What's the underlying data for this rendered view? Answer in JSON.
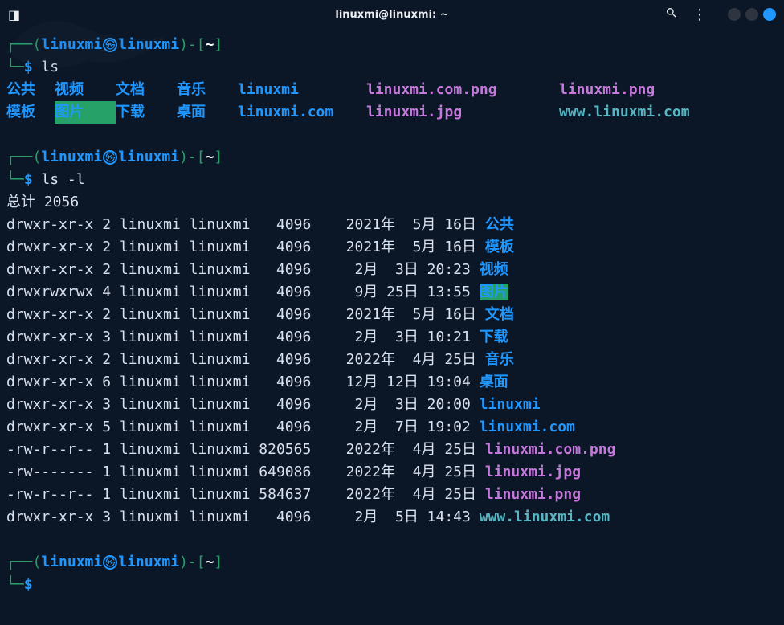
{
  "titlebar": {
    "title": "linuxmi@linuxmi: ~"
  },
  "prompt": {
    "user": "linuxmi",
    "host": "linuxmi",
    "path": "~",
    "symbol": "$"
  },
  "cmd1": "ls",
  "ls_short": {
    "row1": [
      {
        "text": "公共",
        "cls": "dir"
      },
      {
        "text": "视频",
        "cls": "dir"
      },
      {
        "text": "文档",
        "cls": "dir"
      },
      {
        "text": "音乐",
        "cls": "dir"
      },
      {
        "text": "linuxmi",
        "cls": "dir"
      },
      {
        "text": "linuxmi.com.png",
        "cls": "img"
      },
      {
        "text": "linuxmi.png",
        "cls": "img"
      }
    ],
    "row2": [
      {
        "text": "模板",
        "cls": "dir"
      },
      {
        "text": "图片",
        "cls": "dir-ow"
      },
      {
        "text": "下载",
        "cls": "dir"
      },
      {
        "text": "桌面",
        "cls": "dir"
      },
      {
        "text": "linuxmi.com",
        "cls": "dir"
      },
      {
        "text": "linuxmi.jpg",
        "cls": "img"
      },
      {
        "text": "www.linuxmi.com",
        "cls": "lnk"
      }
    ]
  },
  "cmd2": "ls -l",
  "total_line": "总计 2056",
  "long": [
    {
      "perm": "drwxr-xr-x",
      "lnk": "2",
      "own": "linuxmi",
      "grp": "linuxmi",
      "size": "4096",
      "date": "2021年  5月 16日",
      "name": "公共",
      "cls": "dir"
    },
    {
      "perm": "drwxr-xr-x",
      "lnk": "2",
      "own": "linuxmi",
      "grp": "linuxmi",
      "size": "4096",
      "date": "2021年  5月 16日",
      "name": "模板",
      "cls": "dir"
    },
    {
      "perm": "drwxr-xr-x",
      "lnk": "2",
      "own": "linuxmi",
      "grp": "linuxmi",
      "size": "4096",
      "date": " 2月  3日 20:23",
      "name": "视频",
      "cls": "dir"
    },
    {
      "perm": "drwxrwxrwx",
      "lnk": "4",
      "own": "linuxmi",
      "grp": "linuxmi",
      "size": "4096",
      "date": " 9月 25日 13:55",
      "name": "图片",
      "cls": "dir-ow"
    },
    {
      "perm": "drwxr-xr-x",
      "lnk": "2",
      "own": "linuxmi",
      "grp": "linuxmi",
      "size": "4096",
      "date": "2021年  5月 16日",
      "name": "文档",
      "cls": "dir"
    },
    {
      "perm": "drwxr-xr-x",
      "lnk": "3",
      "own": "linuxmi",
      "grp": "linuxmi",
      "size": "4096",
      "date": " 2月  3日 10:21",
      "name": "下载",
      "cls": "dir"
    },
    {
      "perm": "drwxr-xr-x",
      "lnk": "2",
      "own": "linuxmi",
      "grp": "linuxmi",
      "size": "4096",
      "date": "2022年  4月 25日",
      "name": "音乐",
      "cls": "dir"
    },
    {
      "perm": "drwxr-xr-x",
      "lnk": "6",
      "own": "linuxmi",
      "grp": "linuxmi",
      "size": "4096",
      "date": "12月 12日 19:04",
      "name": "桌面",
      "cls": "dir"
    },
    {
      "perm": "drwxr-xr-x",
      "lnk": "3",
      "own": "linuxmi",
      "grp": "linuxmi",
      "size": "4096",
      "date": " 2月  3日 20:00",
      "name": "linuxmi",
      "cls": "dir"
    },
    {
      "perm": "drwxr-xr-x",
      "lnk": "5",
      "own": "linuxmi",
      "grp": "linuxmi",
      "size": "4096",
      "date": " 2月  7日 19:02",
      "name": "linuxmi.com",
      "cls": "dir"
    },
    {
      "perm": "-rw-r--r--",
      "lnk": "1",
      "own": "linuxmi",
      "grp": "linuxmi",
      "size": "820565",
      "date": "2022年  4月 25日",
      "name": "linuxmi.com.png",
      "cls": "img"
    },
    {
      "perm": "-rw-------",
      "lnk": "1",
      "own": "linuxmi",
      "grp": "linuxmi",
      "size": "649086",
      "date": "2022年  4月 25日",
      "name": "linuxmi.jpg",
      "cls": "img"
    },
    {
      "perm": "-rw-r--r--",
      "lnk": "1",
      "own": "linuxmi",
      "grp": "linuxmi",
      "size": "584637",
      "date": "2022年  4月 25日",
      "name": "linuxmi.png",
      "cls": "img"
    },
    {
      "perm": "drwxr-xr-x",
      "lnk": "3",
      "own": "linuxmi",
      "grp": "linuxmi",
      "size": "4096",
      "date": " 2月  5日 14:43",
      "name": "www.linuxmi.com",
      "cls": "lnk"
    }
  ]
}
